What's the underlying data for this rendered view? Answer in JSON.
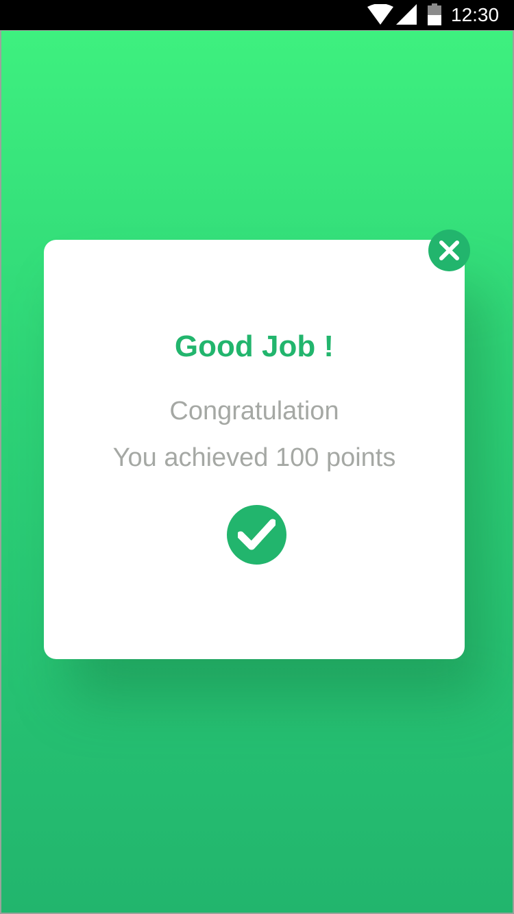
{
  "status_bar": {
    "time": "12:30",
    "icons": [
      "wifi-icon",
      "cellular-signal-icon",
      "battery-icon"
    ]
  },
  "colors": {
    "background_top": "#3ef07f",
    "background_bottom": "#22b56d",
    "accent": "#22b56d",
    "dialog": "#ffffff",
    "body_text": "#a5a8a4"
  },
  "dialog": {
    "title": "Good Job !",
    "message_line1": "Congratulation",
    "message_line2": "You achieved 100 points",
    "close_icon": "close-icon",
    "badge_icon": "checkmark-icon"
  }
}
